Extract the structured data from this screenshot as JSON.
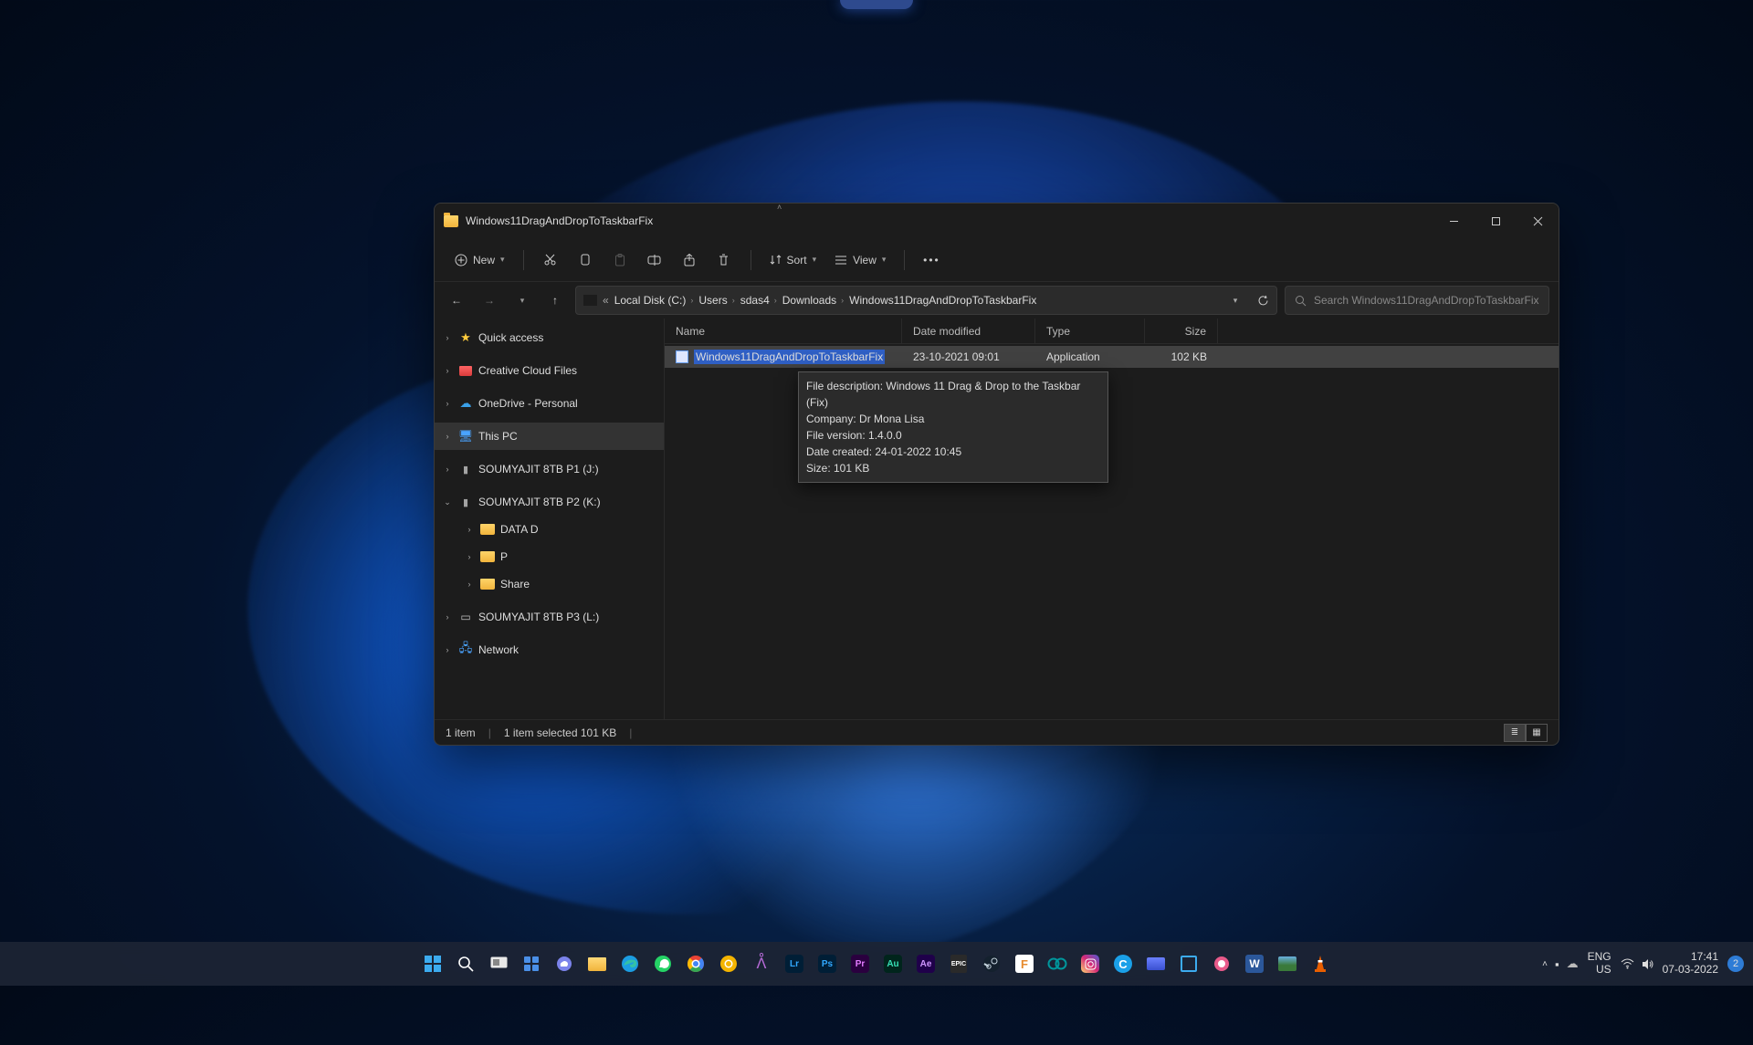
{
  "window": {
    "title": "Windows11DragAndDropToTaskbarFix",
    "toolbar": {
      "new": "New",
      "sort": "Sort",
      "view": "View"
    },
    "breadcrumb_prefix": "«",
    "breadcrumbs": [
      "Local Disk (C:)",
      "Users",
      "sdas4",
      "Downloads",
      "Windows11DragAndDropToTaskbarFix"
    ],
    "search_placeholder": "Search Windows11DragAndDropToTaskbarFix",
    "columns": {
      "name": "Name",
      "date": "Date modified",
      "type": "Type",
      "size": "Size"
    },
    "sidebar": [
      {
        "label": "Quick access",
        "icon": "star",
        "exp": "›"
      },
      {
        "label": "Creative Cloud Files",
        "icon": "cc",
        "exp": "›"
      },
      {
        "label": "OneDrive - Personal",
        "icon": "cloud",
        "exp": "›"
      },
      {
        "label": "This PC",
        "icon": "pc",
        "exp": "›",
        "selected": true
      },
      {
        "label": "SOUMYAJIT 8TB P1 (J:)",
        "icon": "drive",
        "exp": "›"
      },
      {
        "label": "SOUMYAJIT 8TB P2 (K:)",
        "icon": "drive",
        "exp": "⌄",
        "children": [
          {
            "label": "DATA D"
          },
          {
            "label": "P"
          },
          {
            "label": "Share"
          }
        ]
      },
      {
        "label": "SOUMYAJIT 8TB P3 (L:)",
        "icon": "drive2",
        "exp": "›"
      },
      {
        "label": "Network",
        "icon": "net",
        "exp": "›"
      }
    ],
    "files": [
      {
        "name": "Windows11DragAndDropToTaskbarFix",
        "date": "23-10-2021 09:01",
        "type": "Application",
        "size": "102 KB",
        "selected": true
      }
    ],
    "tooltip": {
      "l1": "File description: Windows 11 Drag & Drop to the Taskbar (Fix)",
      "l2": "Company: Dr Mona Lisa",
      "l3": "File version: 1.4.0.0",
      "l4": "Date created: 24-01-2022 10:45",
      "l5": "Size: 101 KB"
    },
    "status": {
      "count": "1 item",
      "selected": "1 item selected  101 KB"
    }
  },
  "tray": {
    "lang1": "ENG",
    "lang2": "US",
    "time": "17:41",
    "date": "07-03-2022",
    "notif": "2"
  }
}
